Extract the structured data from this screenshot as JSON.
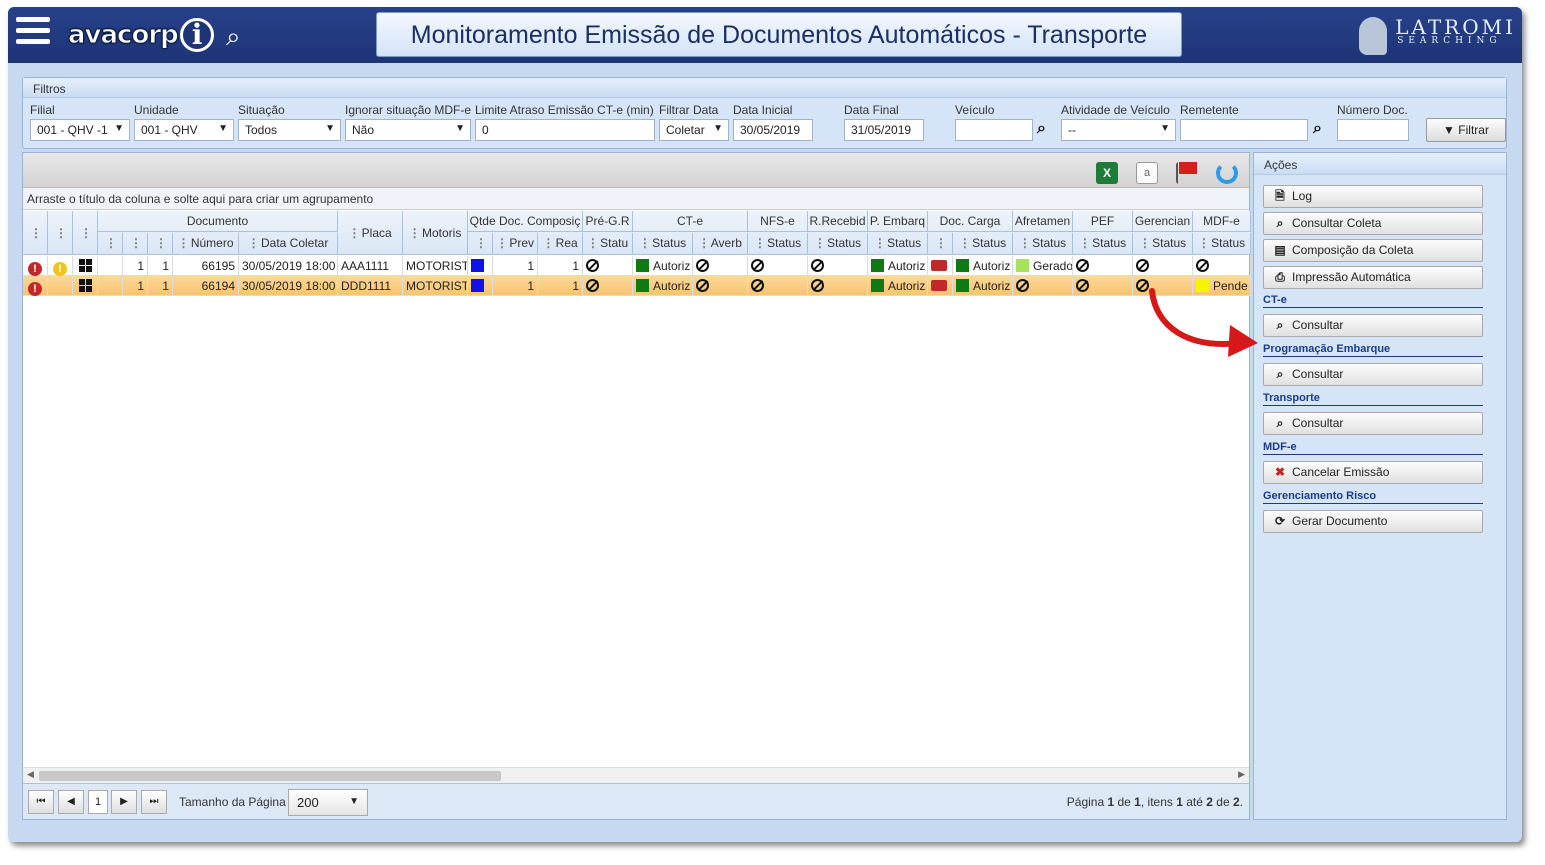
{
  "header": {
    "title": "Monitoramento Emissão de Documentos Automáticos - Transporte",
    "logo_text": "avacorp",
    "brand_name": "LATROMI",
    "brand_sub": "SEARCHING"
  },
  "filters": {
    "panel_title": "Filtros",
    "filial": {
      "label": "Filial",
      "value": "001 - QHV -1"
    },
    "unidade": {
      "label": "Unidade",
      "value": "001 - QHV"
    },
    "situacao": {
      "label": "Situação",
      "value": "Todos"
    },
    "ignorar": {
      "label": "Ignorar situação MDF-e",
      "value": "Não"
    },
    "limite": {
      "label": "Limite Atraso Emissão CT-e (min)",
      "value": "0"
    },
    "filtrar_data": {
      "label": "Filtrar Data",
      "value": "Coletar"
    },
    "data_inicial": {
      "label": "Data Inicial",
      "value": "30/05/2019"
    },
    "data_final": {
      "label": "Data Final",
      "value": "31/05/2019"
    },
    "veiculo": {
      "label": "Veículo",
      "value": ""
    },
    "atividade": {
      "label": "Atividade de Veículo",
      "value": "--"
    },
    "remetente": {
      "label": "Remetente",
      "value": ""
    },
    "numero_doc": {
      "label": "Número Doc.",
      "value": ""
    },
    "filtrar_button": "Filtrar"
  },
  "grid": {
    "group_hint": "Arraste o título da coluna e solte aqui para criar um agrupamento",
    "group_headers": {
      "documento": "Documento",
      "placa": "Placa",
      "motorista": "Motoris",
      "qtde": "Qtde Doc. Composiç",
      "pre_gr": "Pré-G.R",
      "cte": "CT-e",
      "nfse": "NFS-e",
      "rrecebido": "R.Recebid",
      "pembarque": "P. Embarq",
      "doccarga": "Doc. Carga",
      "afretamento": "Afretamen",
      "pef": "PEF",
      "gerenciamento": "Gerencian",
      "mdfe": "MDF-e"
    },
    "sub_headers": {
      "numero": "Número",
      "data_coletar": "Data Coletar",
      "prev": "Prev",
      "real": "Rea",
      "status": "Status",
      "status_short": "Statu",
      "averb": "Averb"
    },
    "rows": [
      {
        "c1": "1",
        "c2": "1",
        "numero": "66195",
        "data": "30/05/2019 18:00",
        "placa": "AAA1111",
        "motorista": "MOTORIST",
        "prev": "1",
        "real": "1",
        "cte_status": "Autoriz",
        "pemb_status": "Autoriz",
        "doc_status": "Autoriz",
        "afret_status": "Gerado",
        "mdfe_status": "",
        "selected": false
      },
      {
        "c1": "1",
        "c2": "1",
        "numero": "66194",
        "data": "30/05/2019 18:00",
        "placa": "DDD1111",
        "motorista": "MOTORIST",
        "prev": "1",
        "real": "1",
        "cte_status": "Autoriz",
        "pemb_status": "Autoriz",
        "doc_status": "Autoriz",
        "afret_status": "",
        "mdfe_status": "Pende",
        "selected": true
      }
    ]
  },
  "pager": {
    "current_page": "1",
    "page_size_label": "Tamanho da Página",
    "page_size": "200",
    "info_prefix": "Página ",
    "info_page": "1",
    "info_of": " de ",
    "info_total": "1",
    "info_items": ", itens ",
    "info_from": "1",
    "info_to_label": " até ",
    "info_to": "2",
    "info_de": " de ",
    "info_count": "2",
    "info_end": "."
  },
  "actions": {
    "title": "Ações",
    "log": "Log",
    "consultar_coleta": "Consultar Coleta",
    "composicao": "Composição da Coleta",
    "impressao": "Impressão Automática",
    "sec_cte": "CT-e",
    "cte_consultar": "Consultar",
    "sec_prog": "Programação Embarque",
    "prog_consultar": "Consultar",
    "sec_transporte": "Transporte",
    "transp_consultar": "Consultar",
    "sec_mdfe": "MDF-e",
    "cancelar": "Cancelar Emissão",
    "sec_risco": "Gerenciamento Risco",
    "gerar": "Gerar Documento"
  },
  "colors": {
    "header_bg": "#1d3475",
    "status_green": "#0f7a13",
    "status_blue": "#1010e8",
    "status_lime": "#a6e35a",
    "status_yellow": "#f5f500",
    "alert_red": "#c0282a"
  }
}
